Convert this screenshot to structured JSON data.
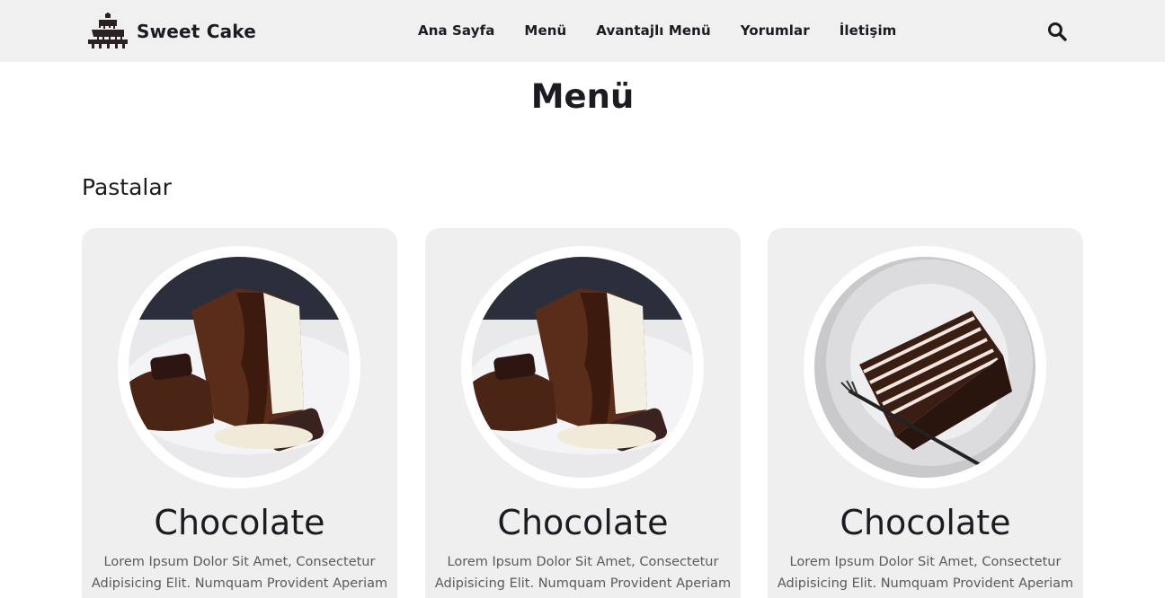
{
  "brand": {
    "name": "Sweet Cake",
    "logo_icon": "cake-icon"
  },
  "nav": {
    "items": [
      {
        "label": "Ana Sayfa"
      },
      {
        "label": "Menü"
      },
      {
        "label": "Avantajlı Menü"
      },
      {
        "label": "Yorumlar"
      },
      {
        "label": "İletişim"
      }
    ],
    "search_icon": "search-icon"
  },
  "page": {
    "title": "Menü",
    "section": "Pastalar"
  },
  "products": [
    {
      "name": "Chocolate",
      "description": "Lorem Ipsum Dolor Sit Amet, Consectetur Adipisicing Elit. Numquam Provident Aperiam",
      "image": "chocolate-lava-cake-photo"
    },
    {
      "name": "Chocolate",
      "description": "Lorem Ipsum Dolor Sit Amet, Consectetur Adipisicing Elit. Numquam Provident Aperiam",
      "image": "chocolate-lava-cake-photo"
    },
    {
      "name": "Chocolate",
      "description": "Lorem Ipsum Dolor Sit Amet, Consectetur Adipisicing Elit. Numquam Provident Aperiam",
      "image": "layered-chocolate-cake-slice-photo"
    }
  ],
  "colors": {
    "navbar_bg": "#f0f0f0",
    "card_bg": "#efefef",
    "text": "#1c1b22",
    "muted_text": "#5a5a5a"
  }
}
